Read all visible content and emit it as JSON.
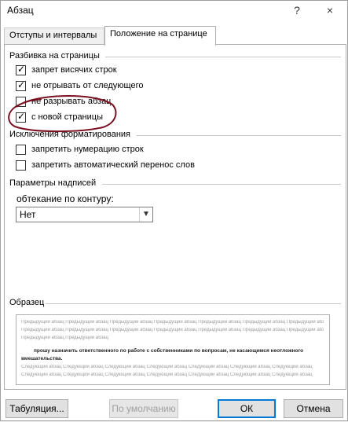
{
  "window": {
    "title": "Абзац",
    "help": "?",
    "close": "×"
  },
  "tabs": [
    {
      "label": "Отступы и интервалы",
      "active": false
    },
    {
      "label": "Положение на странице",
      "active": true
    }
  ],
  "pagination": {
    "title": "Разбивка на страницы",
    "options": [
      {
        "label": "запрет висячих строк",
        "checked": true
      },
      {
        "label": "не отрывать от следующего",
        "checked": true
      },
      {
        "label": "не разрывать абзац",
        "checked": false
      },
      {
        "label": "с новой страницы",
        "checked": true
      }
    ]
  },
  "formatting_exceptions": {
    "title": "Исключения форматирования",
    "options": [
      {
        "label": "запретить нумерацию строк",
        "checked": false
      },
      {
        "label": "запретить автоматический перенос слов",
        "checked": false
      }
    ]
  },
  "textbox_options": {
    "title": "Параметры надписей",
    "wrap_label": "обтекание по контуру:",
    "wrap_value": "Нет"
  },
  "sample": {
    "title": "Образец",
    "prev_text": "Предыдущий абзац Предыдущий абзац Предыдущий абзац Предыдущий абзац Предыдущий абзац Предыдущий абзац Предыдущий абзац",
    "prev_text_short": "Предыдущий абзац Предыдущий абзац",
    "main_text": "прошу назначить ответственного по работе с собственниками по вопросам, не касающимся неотложного",
    "main_text_2": "вмешательства.",
    "next_text": "Следующий абзац Следующий абзац Следующий абзац Следующий абзац Следующий абзац Следующий абзац Следующий абзац"
  },
  "buttons": {
    "tabs": "Табуляция...",
    "default": "По умолчанию",
    "ok": "ОК",
    "cancel": "Отмена"
  },
  "colors": {
    "annotation": "#7a1020",
    "accent": "#0078d7"
  }
}
